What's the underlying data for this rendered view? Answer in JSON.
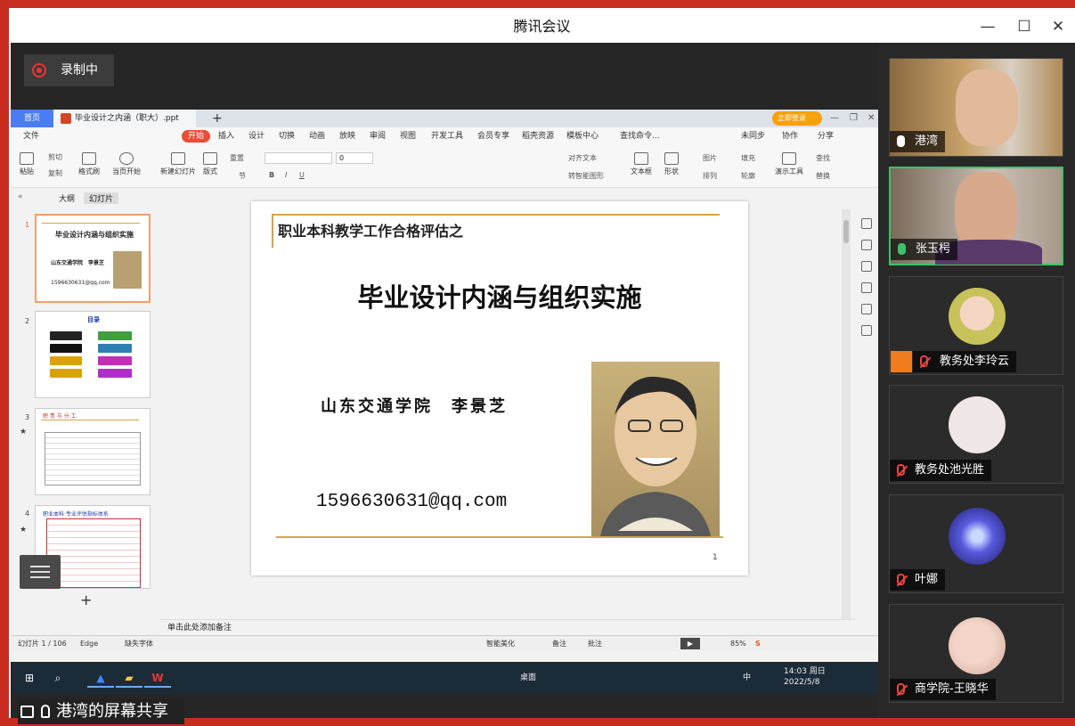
{
  "window": {
    "title": "腾讯会议"
  },
  "recording": {
    "label": "录制中"
  },
  "wps": {
    "tabs": {
      "home": "首页",
      "file": "毕业设计之内涵（职大）.ppt",
      "new": "+"
    },
    "login": "立即登录",
    "menu": [
      "文件",
      "开始",
      "插入",
      "设计",
      "切换",
      "动画",
      "放映",
      "审阅",
      "视图",
      "开发工具",
      "会员专享",
      "稻壳资源",
      "模板中心",
      "查找命令..."
    ],
    "menu_right": [
      "未同步",
      "协作",
      "分享"
    ],
    "ribbon": {
      "paste": "粘贴",
      "cut": "剪切",
      "copy": "复制",
      "format_painter": "格式刷",
      "play": "当页开始",
      "new_slide": "新建幻灯片",
      "layout": "版式",
      "section": "节",
      "reset": "重置",
      "font_size": "0",
      "text_box": "文本框",
      "shape": "形状",
      "arrange": "排列",
      "presentation_tools": "演示工具",
      "find": "查找",
      "replace": "替换",
      "align_text": "对齐文本",
      "smart_graphic": "转智能图形",
      "picture": "图片",
      "fill": "填充",
      "outline": "轮廓"
    },
    "left_pane": {
      "tab_outline": "大纲",
      "tab_slides": "幻灯片",
      "add": "+"
    },
    "thumbs": [
      {
        "num": "1",
        "title": "毕业设计内涵与组织实施",
        "name": "山东交通学院　李景芝",
        "email": "1596630631@qq.com"
      },
      {
        "num": "2",
        "title": "目录"
      },
      {
        "num": "3",
        "header": "职 责 与 分 工"
      },
      {
        "num": "4",
        "header": "职业本科·专业评估指标体系"
      }
    ],
    "slide": {
      "subtitle": "职业本科教学工作合格评估之",
      "title": "毕业设计内涵与组织实施",
      "school": "山东交通学院　李景芝",
      "email": "1596630631@qq.com",
      "page": "1"
    },
    "notes": "单击此处添加备注",
    "status": {
      "slide": "幻灯片 1 / 106",
      "theme": "Edge",
      "font": "缺失字体",
      "beautify": "智能美化",
      "note": "备注",
      "comment": "批注",
      "zoom": "85%"
    }
  },
  "taskbar": {
    "desktop": "桌面",
    "time": "14:03 周日",
    "date": "2022/5/8",
    "ime": "中"
  },
  "share_label": "港湾的屏幕共享",
  "participants": [
    {
      "name": "港湾",
      "muted": false,
      "video": true
    },
    {
      "name": "张玉枵",
      "muted": false,
      "video": true,
      "speaking": true
    },
    {
      "name": "教务处李玲云",
      "muted": true
    },
    {
      "name": "教务处池光胜",
      "muted": true
    },
    {
      "name": "叶娜",
      "muted": true
    },
    {
      "name": "商学院-王晓华",
      "muted": true
    }
  ],
  "colors": {
    "accent_red": "#c62d1f",
    "wps_orange": "#ea4c36",
    "slide_gold": "#d2a54b",
    "speaking_green": "#3ac36a"
  }
}
